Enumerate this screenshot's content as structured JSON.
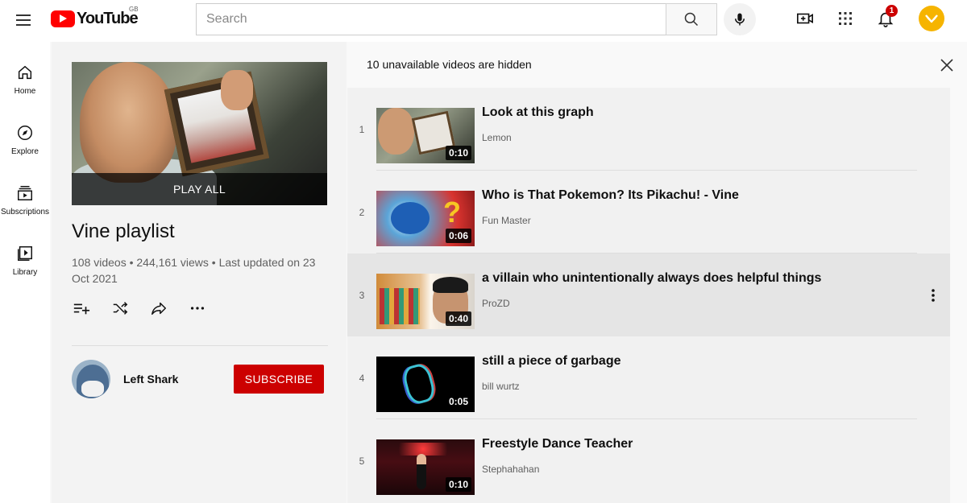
{
  "topbar": {
    "logo_text": "YouTube",
    "logo_region": "GB",
    "search_placeholder": "Search",
    "notification_count": "1"
  },
  "guide": {
    "items": [
      {
        "label": "Home",
        "icon": "home-icon"
      },
      {
        "label": "Explore",
        "icon": "compass-icon"
      },
      {
        "label": "Subscriptions",
        "icon": "subscriptions-icon"
      },
      {
        "label": "Library",
        "icon": "library-icon"
      }
    ]
  },
  "playlist": {
    "play_all": "PLAY ALL",
    "title": "Vine playlist",
    "stats": "108 videos • 244,161 views • Last updated on 23 Oct 2021",
    "owner": "Left Shark",
    "subscribe": "SUBSCRIBE"
  },
  "list": {
    "notice": "10 unavailable videos are hidden",
    "videos": [
      {
        "index": "1",
        "title": "Look at this graph",
        "channel": "Lemon",
        "duration": "0:10"
      },
      {
        "index": "2",
        "title": "Who is That Pokemon? Its Pikachu! - Vine",
        "channel": "Fun Master",
        "duration": "0:06"
      },
      {
        "index": "3",
        "title": "a villain who unintentionally always does helpful things",
        "channel": "ProZD",
        "duration": "0:40"
      },
      {
        "index": "4",
        "title": "still a piece of garbage",
        "channel": "bill wurtz",
        "duration": "0:05"
      },
      {
        "index": "5",
        "title": "Freestyle Dance Teacher",
        "channel": "Stephahahan",
        "duration": "0:10"
      }
    ]
  },
  "colors": {
    "brand_red": "#ff0000",
    "subscribe_red": "#cc0000",
    "avatar_yellow": "#f6b400"
  }
}
